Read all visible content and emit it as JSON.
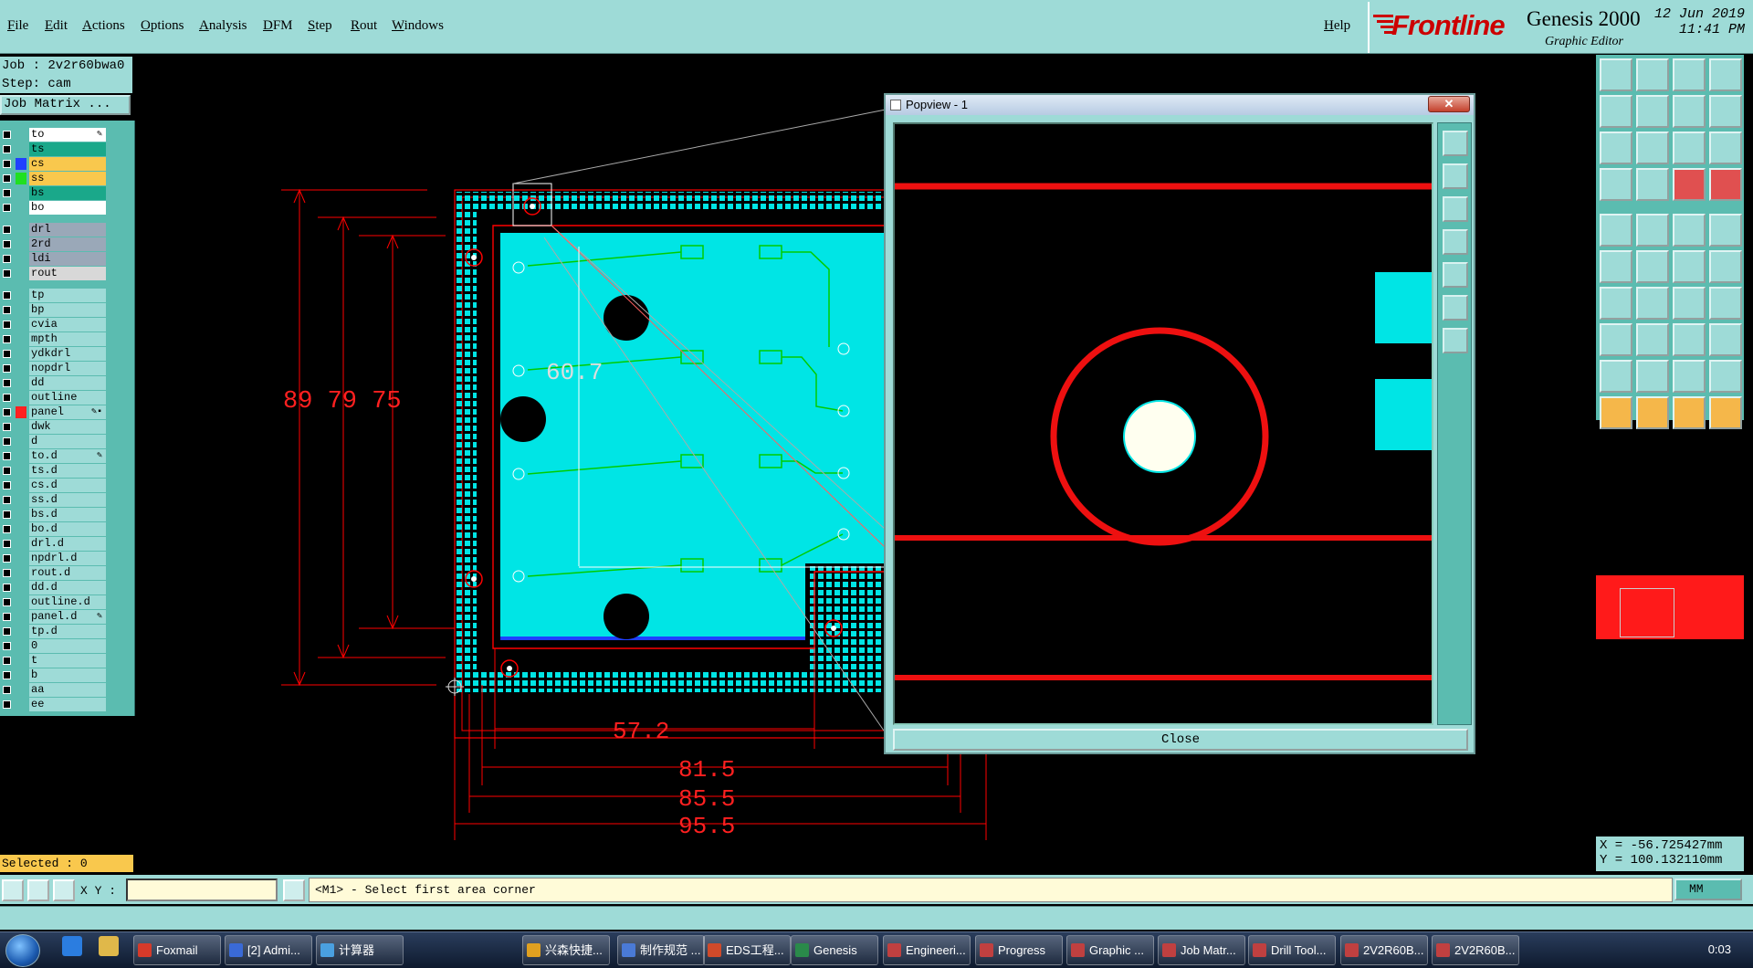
{
  "menu": {
    "items": [
      "File",
      "Edit",
      "Actions",
      "Options",
      "Analysis",
      "DFM",
      "Step",
      "Rout",
      "Windows"
    ],
    "help": "Help"
  },
  "branding": {
    "logo": "Frontline",
    "product": "Genesis 2000",
    "subtitle": "Graphic Editor",
    "date": "12 Jun 2019",
    "time": "11:41 PM"
  },
  "job": {
    "job_line": "Job : 2v2r60bwa0",
    "step_line": "Step: cam",
    "matrix_button": "Job Matrix ..."
  },
  "layers": [
    {
      "name": "to",
      "color": "#ffffff",
      "swatch": "",
      "mark": "✎"
    },
    {
      "name": "ts",
      "color": "#1aa88a",
      "swatch": "",
      "mark": ""
    },
    {
      "name": "cs",
      "color": "#f9c84d",
      "swatch": "#2040ff",
      "mark": ""
    },
    {
      "name": "ss",
      "color": "#f9c84d",
      "swatch": "#20e020",
      "mark": ""
    },
    {
      "name": "bs",
      "color": "#1aa88a",
      "swatch": "",
      "mark": ""
    },
    {
      "name": "bo",
      "color": "#ffffff",
      "swatch": "",
      "mark": ""
    },
    {
      "name": "drl",
      "color": "#9aa8b8",
      "swatch": "",
      "mark": ""
    },
    {
      "name": "2rd",
      "color": "#9aa8b8",
      "swatch": "",
      "mark": ""
    },
    {
      "name": "ldi",
      "color": "#9aa8b8",
      "swatch": "",
      "mark": ""
    },
    {
      "name": "rout",
      "color": "#d8d8d8",
      "swatch": "",
      "mark": ""
    },
    {
      "name": "tp",
      "color": "#9edbd7",
      "swatch": "",
      "mark": ""
    },
    {
      "name": "bp",
      "color": "#9edbd7",
      "swatch": "",
      "mark": ""
    },
    {
      "name": "cvia",
      "color": "#9edbd7",
      "swatch": "",
      "mark": ""
    },
    {
      "name": "mpth",
      "color": "#9edbd7",
      "swatch": "",
      "mark": ""
    },
    {
      "name": "ydkdrl",
      "color": "#9edbd7",
      "swatch": "",
      "mark": ""
    },
    {
      "name": "nopdrl",
      "color": "#9edbd7",
      "swatch": "",
      "mark": ""
    },
    {
      "name": "dd",
      "color": "#9edbd7",
      "swatch": "",
      "mark": ""
    },
    {
      "name": "outline",
      "color": "#9edbd7",
      "swatch": "",
      "mark": ""
    },
    {
      "name": "panel",
      "color": "#9edbd7",
      "swatch": "#ff2020",
      "mark": "✎▪"
    },
    {
      "name": "dwk",
      "color": "#9edbd7",
      "swatch": "",
      "mark": ""
    },
    {
      "name": "d",
      "color": "#9edbd7",
      "swatch": "",
      "mark": ""
    },
    {
      "name": "to.d",
      "color": "#9edbd7",
      "swatch": "",
      "mark": "✎"
    },
    {
      "name": "ts.d",
      "color": "#9edbd7",
      "swatch": "",
      "mark": ""
    },
    {
      "name": "cs.d",
      "color": "#9edbd7",
      "swatch": "",
      "mark": ""
    },
    {
      "name": "ss.d",
      "color": "#9edbd7",
      "swatch": "",
      "mark": ""
    },
    {
      "name": "bs.d",
      "color": "#9edbd7",
      "swatch": "",
      "mark": ""
    },
    {
      "name": "bo.d",
      "color": "#9edbd7",
      "swatch": "",
      "mark": ""
    },
    {
      "name": "drl.d",
      "color": "#9edbd7",
      "swatch": "",
      "mark": ""
    },
    {
      "name": "npdrl.d",
      "color": "#9edbd7",
      "swatch": "",
      "mark": ""
    },
    {
      "name": "rout.d",
      "color": "#9edbd7",
      "swatch": "",
      "mark": ""
    },
    {
      "name": "dd.d",
      "color": "#9edbd7",
      "swatch": "",
      "mark": ""
    },
    {
      "name": "outline.d",
      "color": "#9edbd7",
      "swatch": "",
      "mark": ""
    },
    {
      "name": "panel.d",
      "color": "#9edbd7",
      "swatch": "",
      "mark": "✎"
    },
    {
      "name": "tp.d",
      "color": "#9edbd7",
      "swatch": "",
      "mark": ""
    },
    {
      "name": "0",
      "color": "#9edbd7",
      "swatch": "",
      "mark": ""
    },
    {
      "name": "t",
      "color": "#9edbd7",
      "swatch": "",
      "mark": ""
    },
    {
      "name": "b",
      "color": "#9edbd7",
      "swatch": "",
      "mark": ""
    },
    {
      "name": "aa",
      "color": "#9edbd7",
      "swatch": "",
      "mark": ""
    },
    {
      "name": "ee",
      "color": "#9edbd7",
      "swatch": "",
      "mark": ""
    }
  ],
  "selected": "Selected : 0",
  "dimensions": {
    "vertical": "89 79 75",
    "inner": "60.7",
    "h1": "57.2",
    "h2": "81.5",
    "h3": "85.5",
    "h4": "95.5"
  },
  "popview": {
    "title": "Popview - 1",
    "close_x": "✕",
    "close_button": "Close"
  },
  "coords": {
    "x": "X = -56.725427mm",
    "y": "Y = 100.132110mm"
  },
  "command": {
    "xy_label": "X Y :",
    "xy_value": "",
    "prompt": "<M1> - Select first area corner",
    "units": "MM"
  },
  "taskbar": {
    "items": [
      "Foxmail",
      "[2] Admi...",
      "计算器",
      "兴森快捷...",
      "制作规范 ...",
      "EDS工程...",
      "Genesis",
      "Engineeri...",
      "Progress",
      "Graphic ...",
      "Job Matr...",
      "Drill Tool...",
      "2V2R60B...",
      "2V2R60B..."
    ],
    "clock": "0:03"
  },
  "colors": {
    "panel": "#9edbd7",
    "board": "#00e5e5",
    "outline": "#ff0000",
    "trace": "#00cc00"
  }
}
